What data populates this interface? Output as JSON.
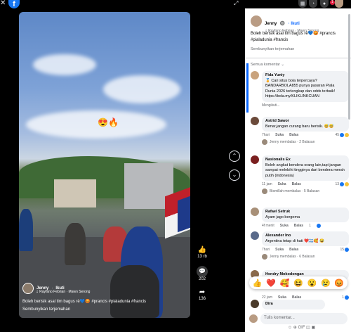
{
  "topbar": {
    "close_icon": "✕",
    "brand": "f",
    "expand_icon": "⤢",
    "notification_count": "1"
  },
  "video": {
    "emoji_overlay": "😍🔥",
    "author": "Jenny",
    "author_dot": "·",
    "follow": "Ikuti",
    "music": "♫ Rayfano Febrian · Mawn Serong",
    "caption": "Boleh berisik asal tim bagus rѐ💙😡 #prancis #pialadunia #francis",
    "hide_translation": "Sembunyikan terjemahan"
  },
  "actions": {
    "like_count": "13 rb",
    "comment_count": "202",
    "share_count": "136"
  },
  "panel": {
    "author": "Jenny",
    "verified": "🔘",
    "follow": "· Ikuti",
    "music": "♫ Rayfano Febrian · Mawn Serong",
    "caption": "Boleh berisik asal tim bagus rѐ💙😡 #prancis #pialadunia #francis",
    "hide_translation": "Sembunyikan terjemahan",
    "sort_label": "Semua komentar ⌄"
  },
  "comments": [
    {
      "name": "Fida Yuniy",
      "text": "🏅 Cari situs bola terpercaya? BANDARBOLA855 punya pasaran Piala Dunia 2026 terlengkap dan odds terbaik! https://bola.my/KLIKLINKCUAN",
      "meta": "Mengikuti..."
    },
    {
      "name": "Astrid Sawor",
      "text": "Benar,jangan curang baru berisik. 😅😅",
      "time": "7hari",
      "like": "Suka",
      "reply": "Balas",
      "react_count": "45",
      "replies": "Jenny membalas · 2 Balasan"
    },
    {
      "name": "Nasionalis Ex",
      "text": "Boleh angkat bendera orang lain,tapi jangan sampai melebihi tingginya dari bendera merah putih (indonesia)",
      "time": "11 jam",
      "like": "Suka",
      "reply": "Balas",
      "react_count": "13",
      "replies": "Bismillah membalas · 5 Balasan"
    },
    {
      "name": "Rafael Setruk",
      "text": "Ayam jago bergema",
      "time": "4f menit",
      "like": "Suka",
      "reply": "Balas",
      "react_count": "1"
    },
    {
      "name": "Alexander Ino",
      "text": "Argentina tetap di hati ❤️🇦🇷🥰 😂",
      "time": "7hari",
      "like": "Suka",
      "reply": "Balas",
      "react_count": "15",
      "replies": "Jenny membalas · 6 Balasan"
    },
    {
      "name": "Hendry Mokodongan",
      "text": "",
      "time": "22 jam",
      "like": "Suka",
      "reply": "Balas",
      "react_count": "1"
    },
    {
      "name": "Dira",
      "text": "",
      "time": ""
    }
  ],
  "reactions": [
    "👍",
    "❤️",
    "🥰",
    "😆",
    "😮",
    "😢",
    "😡"
  ],
  "composer": {
    "placeholder": "Tulis komentar...",
    "icons": "☺ ⊕ GIF ◫ ▣"
  }
}
